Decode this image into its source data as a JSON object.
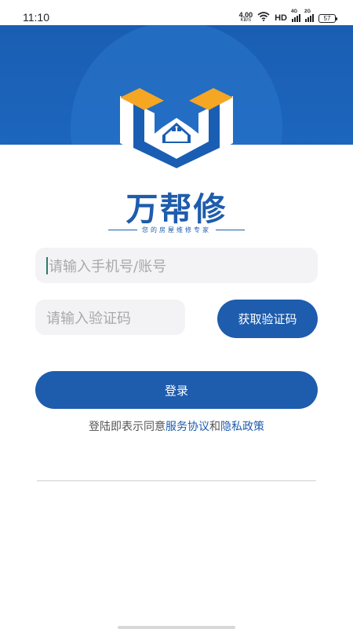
{
  "status_bar": {
    "time": "11:10",
    "net_speed_value": "4.00",
    "net_speed_unit": "KB/S",
    "hd_label": "HD",
    "signal1_tag": "4G",
    "signal2_tag": "2G",
    "battery_level": "57"
  },
  "brand": {
    "name": "万帮修",
    "slogan": "您的房屋维修专家"
  },
  "form": {
    "phone_placeholder": "请输入手机号/账号",
    "code_placeholder": "请输入验证码",
    "get_code_label": "获取验证码",
    "login_label": "登录"
  },
  "agreement": {
    "prefix": "登陆即表示同意",
    "service_link": "服务协议",
    "conjunction": "和",
    "privacy_link": "隐私政策"
  },
  "colors": {
    "primary": "#1e5cad",
    "header_blue": "#1c63b8",
    "roof_orange": "#f5a623",
    "input_bg": "#f3f3f5"
  }
}
